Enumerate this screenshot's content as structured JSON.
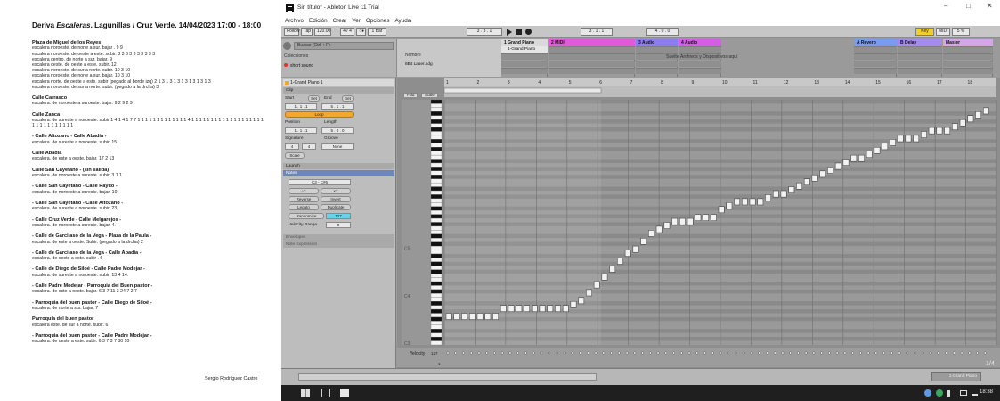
{
  "document": {
    "title_prefix": "Deriva ",
    "title_italic": "Escaleras",
    "title_rest": ". Lagunillas / Cruz Verde. 14/04/2023 17:00 - 18:00",
    "sections": [
      {
        "heading": "Plaza de Miguel de los Reyes",
        "lines": [
          "escalera noroeste. de norte a sur. bajar . 9 9",
          "escalera noroeste. de oeste a este. subir. 3 3 3 3 3 3 3 3 3 3",
          "escalera centro. de norte a sur. bajar. 9",
          "escalera oeste. de oeste a este. subir. 12",
          "escalera noroeste. de sur a norte. subir. 10 3 10",
          "escalera noroeste. de norte a sur. bajar. 10 3 10",
          "escalera norte. de oeste a este. subir (pegado al borde izq) 2 1 3 1 3 1 3 1 3 1 3 1 3 1 3",
          "escalera noroeste. de sur a norte. subir. (pegado a la drcha) 3"
        ]
      },
      {
        "heading": "Calle Carrasco",
        "lines": [
          "escalera. de noroeste a suroeste. bajar. 9 2 9 2 9"
        ]
      },
      {
        "heading": "Calle Zanca",
        "lines": [
          "escalera. de sureste a noroeste. subir 1 4 1 4 1 7 7 1 1 1 1 1 1 1 1 1 1 1 1 1 4 1 1 1 1 1 1 1 1 1 1 1 1 1 1 1 1 1 1 1 1 1 1 1 1 1 1 1 1 1 1"
        ]
      },
      {
        "heading": "- Calle Altozano - Calle Abadía -",
        "lines": [
          "escalera. de sureste a noroeste. subir. 15"
        ]
      },
      {
        "heading": "Calle Abadía",
        "lines": [
          "escalera. de este a oeste. bajar. 17 2 13"
        ]
      },
      {
        "heading": "Calle San Cayetano - (sin salida)",
        "lines": [
          "escalera. de noroeste a sureste. subir. 3 1 1"
        ]
      },
      {
        "heading": "- Calle San Cayetano - Calle Rayito -",
        "lines": [
          "escalera. de noroeste a sureste. bajar. 10."
        ]
      },
      {
        "heading": "- Calle San Cayetano - Calle Altozano -",
        "lines": [
          "escalera. de sureste a noroeste. subir. 23"
        ]
      },
      {
        "heading": "- Calle Cruz Verde - Calle Melgarejos -",
        "lines": [
          "escalera. de noroeste a sureste. bajar. 4."
        ]
      },
      {
        "heading": "- Calle de Garcilaso de la Vega - Plaza de la Paula -",
        "lines": [
          "escalera. de este a oeste. Subir. (pegado a la drcha) 2"
        ]
      },
      {
        "heading": "- Calle de Garcilaso de la Vega - Calle Abadía -",
        "lines": [
          "escalera. de oeste a este. subir . 6"
        ]
      },
      {
        "heading": "- Calle de Diego de Siloé - Calle Padre Modejar -",
        "lines": [
          "escalera. de sureste a noroeste. subir. 13 4 14."
        ]
      },
      {
        "heading": "- Calle Padre Modejar - Parroquia del Buen pastor -",
        "lines": [
          "escalera. de este a oeste. bajar. 6 3 7 11 3 24 7 2 7"
        ]
      },
      {
        "heading": "- Parroquia del buen pastor - Calle Diego de Siloé -",
        "lines": [
          "escalera. de norte a sur. bajar. 7"
        ]
      },
      {
        "heading": "Parroquia del buen pastor",
        "lines": [
          "escalera este. de sur a norte. subir. 6"
        ]
      },
      {
        "heading": "- Parroquia del buen pastor - Calle Padre Modejar -",
        "lines": [
          "escalera. de oeste a este. subir. 6 3 7 3 7 30 10"
        ]
      }
    ],
    "signature": "Sergio Rodríguez Castro"
  },
  "app": {
    "title": "Sin título* - Ableton Live 11 Trial",
    "win_min": "–",
    "win_max": "□",
    "win_close": "✕",
    "menus": [
      "Archivo",
      "Edición",
      "Crear",
      "Ver",
      "Opciones",
      "Ayuda"
    ],
    "transport": {
      "follow": "Follow",
      "tap": "Tap",
      "tempo": "120.00",
      "sig": "4 / 4",
      "metro": "○●",
      "quant": "1 Bar",
      "pos": "3 .  3 .  1",
      "loop_start": "3 .  1 .  1",
      "loop_len": "4 .  0 .  0",
      "key": "Key",
      "midi": "MIDI",
      "cpu": "5 %"
    },
    "browser": {
      "search_placeholder": "Buscar (Ctrl + F)",
      "collections": "Colecciones",
      "item": "short sound",
      "name_header": "Nombre",
      "name_item": "8Bit Laser.adg"
    },
    "tracks": [
      {
        "name": "1 Grand Piano",
        "color": "#d9d9d9",
        "clip": "1-Grand Piano"
      },
      {
        "name": "2 MIDI",
        "color": "#e25ad9",
        "clip": ""
      },
      {
        "name": "3 Audio",
        "color": "#8b7df0",
        "clip": ""
      },
      {
        "name": "4 Audio",
        "color": "#d65ee6",
        "clip": ""
      },
      {
        "name": "A Reverb",
        "color": "#7a9cf0",
        "clip": ""
      },
      {
        "name": "B Delay",
        "color": "#a58af0",
        "clip": ""
      },
      {
        "name": "Master",
        "color": "#d4a6e8",
        "clip": ""
      }
    ],
    "drop_text": "Suelte Archivos y Dispositivos aquí",
    "clip_panel": {
      "clip_name": "1-Grand Piano 1",
      "clip_hdr": "Clip",
      "start": "Start",
      "set": "Set",
      "end": "End",
      "start_val": "1 .  1 .  1",
      "end_val": "5 .  1 .  1",
      "loop": "Loop",
      "position": "Position",
      "length": "Length",
      "pos_val": "1 .  1 .  1",
      "len_val": "5 .  0 .  0",
      "signature": "Signature",
      "groove": "Groove",
      "sig_num": "4",
      "sig_den": "4",
      "groove_val": "None",
      "scale": "Scale",
      "launch": "Launch",
      "notes": "Notes",
      "range": "C3 - C#6",
      "half": "÷2",
      "double": "×2",
      "reverse": "Reverse",
      "invert": "Invert",
      "legato": "Legato",
      "duplicate": "Duplicate",
      "randomize": "Randomize",
      "rand_val": "127",
      "vel_range": "Velocity Range",
      "vel_val": "0",
      "envelopes": "Envelopes",
      "note_expr": "Note Expression"
    },
    "editor": {
      "fold": "Fold",
      "scale_btn": "Scale",
      "bars": [
        "1",
        "1.2",
        "1.3",
        "1.4",
        "2",
        "2.2",
        "2.3",
        "2.4",
        "3",
        "3.2",
        "3.3",
        "3.4",
        "4",
        "4.2",
        "4.3",
        "4.4",
        "5"
      ],
      "bar_labels": [
        "1",
        "2",
        "3",
        "4",
        "5",
        "6",
        "7",
        "8",
        "9",
        "10",
        "11",
        "12",
        "13",
        "14",
        "15",
        "16",
        "17",
        "18"
      ],
      "octaves": [
        "C5",
        "C4",
        "C3"
      ],
      "velocity_label": "Velocity",
      "vel_max": "127",
      "vel_min": "1",
      "grid": "1/4",
      "notes_pitch_from_c3": [
        4,
        4,
        4,
        4,
        4,
        4,
        4,
        6,
        6,
        6,
        6,
        6,
        6,
        6,
        6,
        6,
        7,
        9,
        11,
        13,
        15,
        17,
        19,
        21,
        23,
        25,
        27,
        28,
        29,
        30,
        30,
        30,
        31,
        31,
        31,
        33,
        34,
        35,
        35,
        35,
        35,
        36,
        37,
        38,
        39,
        40,
        41,
        42,
        43,
        44,
        45,
        46,
        47,
        47,
        48,
        49,
        50,
        51,
        52,
        53,
        53,
        54,
        55,
        55,
        55,
        56,
        57,
        58,
        59,
        60
      ]
    },
    "bottom": {
      "selected_track": "1-Grand Piano"
    },
    "taskbar": {
      "clock": "18:38"
    }
  }
}
